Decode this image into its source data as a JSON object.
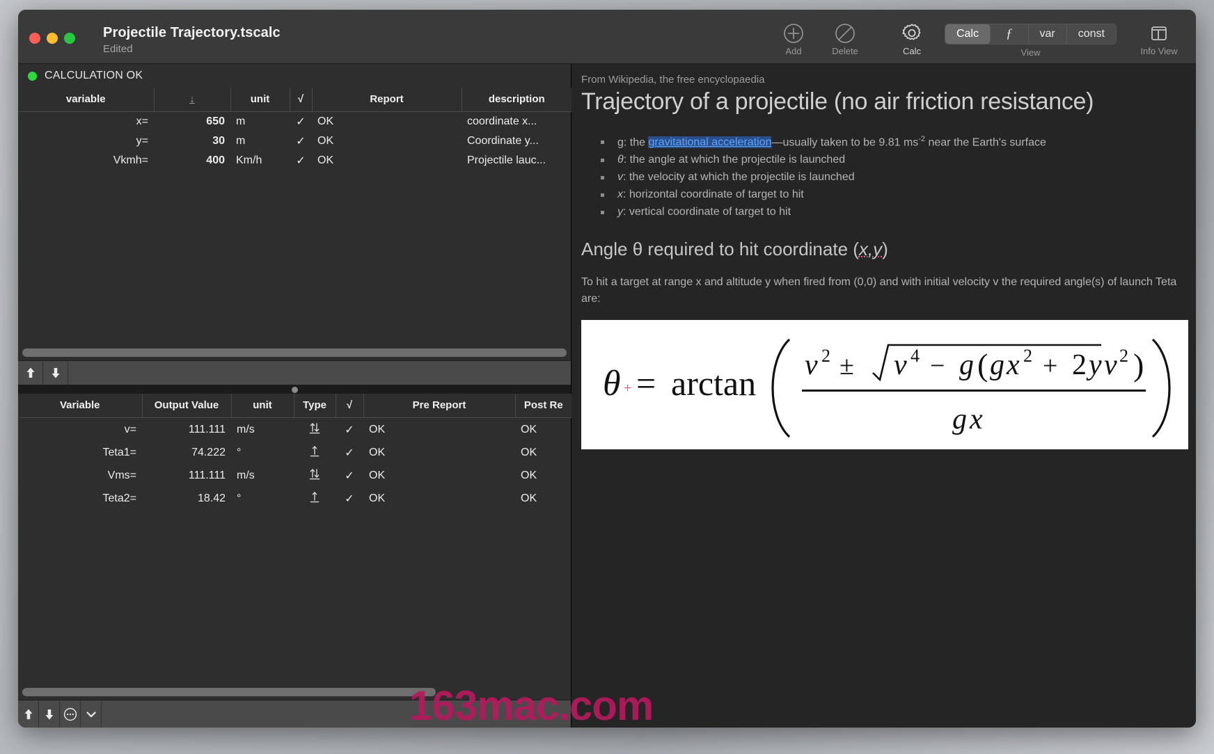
{
  "window": {
    "title": "Projectile Trajectory.tscalc",
    "subtitle": "Edited",
    "traffic_lights": [
      "close-button",
      "minimize-button",
      "zoom-button"
    ]
  },
  "toolbar": {
    "add": {
      "label": "Add",
      "icon": "plus-circle-icon"
    },
    "delete": {
      "label": "Delete",
      "icon": "no-entry-icon"
    },
    "calc": {
      "label": "Calc",
      "icon": "gear-icon"
    },
    "view": {
      "group_label": "View",
      "options": [
        "Calc",
        "ƒ",
        "var",
        "const"
      ],
      "selected": "Calc"
    },
    "info_view": {
      "label": "Info View",
      "icon": "panel-layout-icon"
    }
  },
  "status": {
    "text": "CALCULATION OK",
    "dot_color": "#2fd83f"
  },
  "input_table": {
    "columns": [
      "variable",
      "↓",
      "unit",
      "√",
      "Report",
      "description"
    ],
    "rows": [
      {
        "variable": "x=",
        "value": "650",
        "unit": "m",
        "check": "✓",
        "report": "OK",
        "description": "coordinate x..."
      },
      {
        "variable": "y=",
        "value": "30",
        "unit": "m",
        "check": "✓",
        "report": "OK",
        "description": "Coordinate y..."
      },
      {
        "variable": "Vkmh=",
        "value": "400",
        "unit": "Km/h",
        "check": "✓",
        "report": "OK",
        "description": "Projectile lauc..."
      }
    ]
  },
  "output_table": {
    "columns": [
      "Variable",
      "Output Value",
      "unit",
      "Type",
      "√",
      "Pre Report",
      "Post Re"
    ],
    "rows": [
      {
        "variable": "v=",
        "value": "111.111",
        "unit": "m/s",
        "type": "updown-arrow-icon",
        "check": "✓",
        "pre_report": "OK",
        "post_report": "OK"
      },
      {
        "variable": "Teta1=",
        "value": "74.222",
        "unit": "°",
        "type": "up-arrow-icon",
        "check": "✓",
        "pre_report": "OK",
        "post_report": "OK"
      },
      {
        "variable": "Vms=",
        "value": "111.111",
        "unit": "m/s",
        "type": "updown-arrow-icon",
        "check": "✓",
        "pre_report": "OK",
        "post_report": "OK"
      },
      {
        "variable": "Teta2=",
        "value": "18.42",
        "unit": "°",
        "type": "up-arrow-icon",
        "check": "✓",
        "pre_report": "OK",
        "post_report": "OK"
      }
    ]
  },
  "mini_toolbars": {
    "move_up": "up-arrow-icon",
    "move_down": "down-arrow-icon",
    "more": "ellipsis-circle-icon",
    "chevron": "chevron-down-icon"
  },
  "article": {
    "source_line": "From Wikipedia, the free encyclopaedia",
    "title": "Trajectory of a projectile (no air friction resistance)",
    "bullets": [
      {
        "prefix": "g: the ",
        "link": "gravitational acceleration",
        "mid": "—usually taken to be 9.81 ms",
        "sup": "-2",
        "suffix": " near the Earth's surface"
      },
      {
        "symbol": "θ",
        "text": ": the angle at which the projectile is launched"
      },
      {
        "symbol": "v",
        "text": ": the velocity at which the projectile is launched"
      },
      {
        "symbol": "x",
        "text": ": horizontal coordinate of target to hit"
      },
      {
        "symbol": "y",
        "text": ": vertical coordinate of target to hit"
      }
    ],
    "section_heading_pre": "Angle θ required to hit coordinate (",
    "section_heading_mis": "x,y",
    "section_heading_post": ")",
    "paragraph": "To hit a target at range x and altitude y when fired from (0,0) and with initial velocity v the required angle(s) of launch Teta are:",
    "formula_alt": "θ = arctan( ( v² ± √(v⁴ − g(gx² + 2yv²)) ) / gx )"
  },
  "watermark": {
    "text": "163mac.com",
    "color": "#b51a5e"
  }
}
